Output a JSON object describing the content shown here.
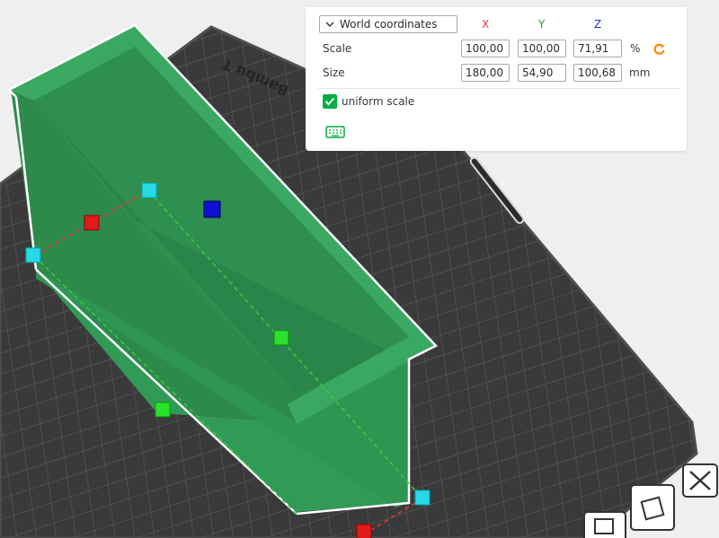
{
  "panel": {
    "coord_system": "World coordinates",
    "axes": [
      "X",
      "Y",
      "Z"
    ],
    "axis_colors": [
      "#e53935",
      "#1aa33c",
      "#2131d6"
    ],
    "scale": {
      "label": "Scale",
      "x": "100,00",
      "y": "100,00",
      "z": "71,91",
      "unit": "%"
    },
    "size": {
      "label": "Size",
      "x": "180,00",
      "y": "54,90",
      "z": "100,68",
      "unit": "mm"
    },
    "uniform_scale": {
      "label": "uniform scale",
      "checked": true
    }
  },
  "plate": {
    "brand": "Bambu T"
  },
  "colors": {
    "accent": "#00ae42",
    "reset": "#ff8a00",
    "object": "#2f9a54"
  },
  "icons": {
    "dropdown": "chevron-down-icon",
    "reset": "reset-rotate-icon",
    "keyboard": "keyboard-icon",
    "toolbar": [
      "arrange-icon",
      "orient-icon",
      "close-icon"
    ]
  }
}
